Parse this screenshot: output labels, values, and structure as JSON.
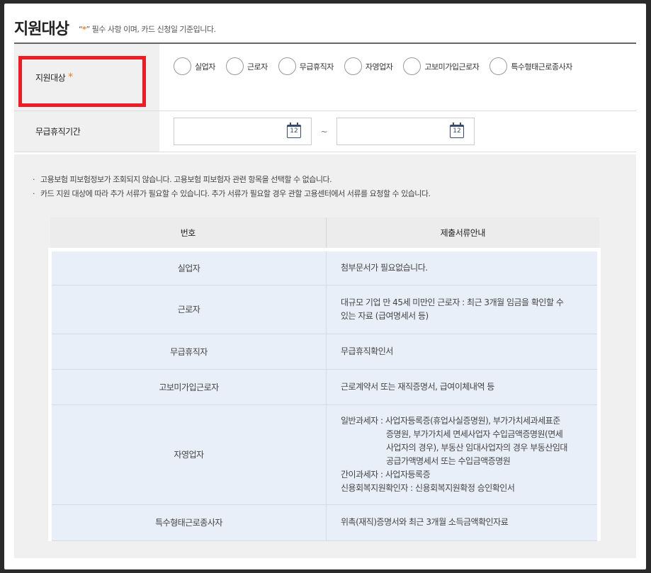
{
  "header": {
    "title": "지원대상",
    "note_prefix": "“",
    "note_star": "*",
    "note_suffix": "” 필수 사항 이며, 카드 신청일 기준입니다."
  },
  "form": {
    "target_label": "지원대상",
    "required_star": "*",
    "target_options": [
      "실업자",
      "근로자",
      "무급휴직자",
      "자영업자",
      "고보미가입근로자",
      "특수형태근로종사자"
    ],
    "period_label": "무급휴직기간",
    "date_start_value": "",
    "date_end_value": "",
    "calendar_icon_text": "12",
    "range_separator": "~"
  },
  "notes": [
    "고용보험 피보험정보가 조회되지 않습니다. 고용보험 피보험자 관련 항목을 선택할 수 없습니다.",
    "카드 지원 대상에 따라 추가 서류가 필요할 수 있습니다. 추가 서류가 필요할 경우 관할 고용센터에서 서류를 요청할 수 있습니다."
  ],
  "note_bullet": "·",
  "doc_table": {
    "headers": [
      "번호",
      "제출서류안내"
    ],
    "rows": [
      {
        "name": "실업자",
        "desc": [
          "첨부문서가 필요없습니다."
        ]
      },
      {
        "name": "근로자",
        "desc": [
          "대규모 기업 만 45세 미만인 근로자 : 최근 3개월 임금을 확인할 수",
          "있는 자료 (급여명세서 등)"
        ]
      },
      {
        "name": "무급휴직자",
        "desc": [
          "무급휴직확인서"
        ]
      },
      {
        "name": "고보미가입근로자",
        "desc": [
          "근로계약서 또는 재직증명서, 급여이체내역 등"
        ]
      },
      {
        "name": "자영업자",
        "desc": [
          "일반과세자 : 사업자등록증(휴업사실증명원), 부가가치세과세표준",
          "증명원, 부가가치세 면세사업자 수입금액증명원(면세",
          "사업자의 경우), 부동산 임대사업자의 경우 부동산임대",
          "공급가액명세서 또는 수입금액증명원",
          "간이과세자 : 사업자등록증",
          "신용회복지원확인자 : 신용회복지원확정 승인확인서"
        ]
      },
      {
        "name": "특수형태근로종사자",
        "desc": [
          "위촉(재직)증명서와 최근 3개월 소득금액확인자료"
        ]
      }
    ]
  },
  "colors": {
    "accent_star": "#f47a20",
    "highlight_box": "#ee1c25",
    "table_body_bg": "#e9eff9"
  }
}
